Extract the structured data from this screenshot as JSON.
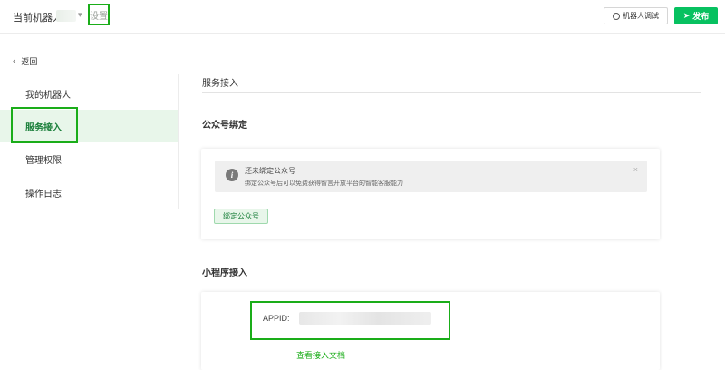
{
  "topbar": {
    "robot_label": "当前机器人",
    "settings_tab": "设置",
    "test_button": "机器人调试",
    "publish_button": "发布"
  },
  "sidebar": {
    "back": "返回",
    "items": [
      {
        "label": "我的机器人"
      },
      {
        "label": "服务接入"
      },
      {
        "label": "管理权限"
      },
      {
        "label": "操作日志"
      }
    ]
  },
  "main": {
    "heading": "服务接入",
    "official_account": {
      "title": "公众号绑定",
      "alert_title": "还未绑定公众号",
      "alert_desc": "绑定公众号后可以免费获得智言开放平台的智能客服能力",
      "close": "×",
      "bind_button": "绑定公众号"
    },
    "mini_program": {
      "title": "小程序接入",
      "appid_label": "APPID:",
      "docs_link": "查看接入文档"
    }
  },
  "colors": {
    "accent": "#07c160",
    "highlight_outline": "#1aad19",
    "active_bg": "#e8f6ea"
  }
}
